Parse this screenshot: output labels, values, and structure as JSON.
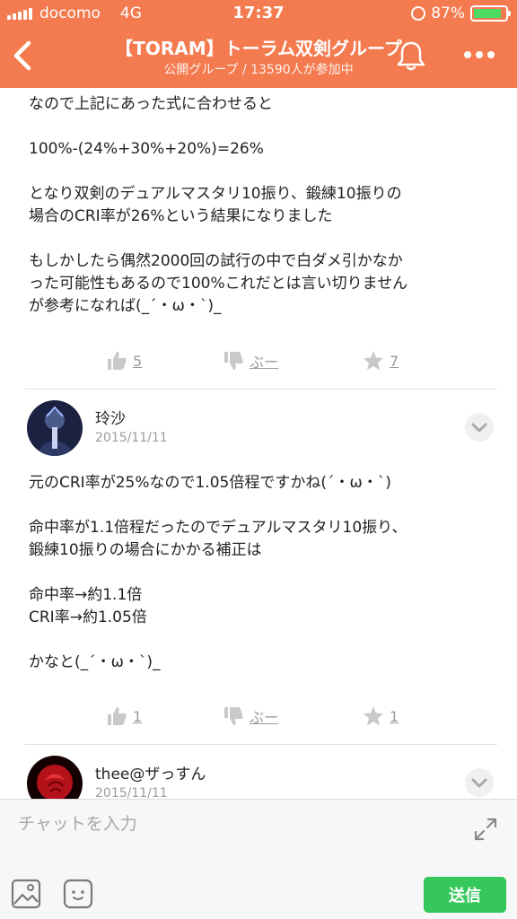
{
  "status_bar": {
    "carrier": "docomo",
    "network": "4G",
    "time": "17:37",
    "battery": "87%",
    "battery_level": 0.87
  },
  "header": {
    "title": "【TORAM】トーラム双剣グループ",
    "subtitle": "公開グループ / 13590人が参加中"
  },
  "post": {
    "text": "なので上記にあった式に合わせると\n\n100%-(24%+30%+20%)=26%\n\nとなり双剣のデュアルマスタリ10振り、鍛練10振りの\n場合のCRI率が26%という結果になりました\n\nもしかしたら偶然2000回の試行の中で白ダメ引かなか\nった可能性もあるので100%これだとは言い切りません\nが参考になれば(_´・ω・`)_",
    "likes": "5",
    "boo": "ぶー",
    "stars": "7"
  },
  "comment1": {
    "name": "玲沙",
    "date": "2015/11/11",
    "text": "元のCRI率が25%なので1.05倍程ですかね(´・ω・`)\n\n命中率が1.1倍程だったのでデュアルマスタリ10振り、\n鍛練10振りの場合にかかる補正は\n\n命中率→約1.1倍\nCRI率→約1.05倍\n\nかなと(_´・ω・`)_",
    "likes": "1",
    "boo": "ぶー",
    "stars": "1"
  },
  "comment2": {
    "name": "thee@ザっすん",
    "date": "2015/11/11"
  },
  "input": {
    "placeholder": "チャットを入力",
    "send_label": "送信"
  },
  "colors": {
    "header": "#f47a4f",
    "send": "#35c759"
  }
}
